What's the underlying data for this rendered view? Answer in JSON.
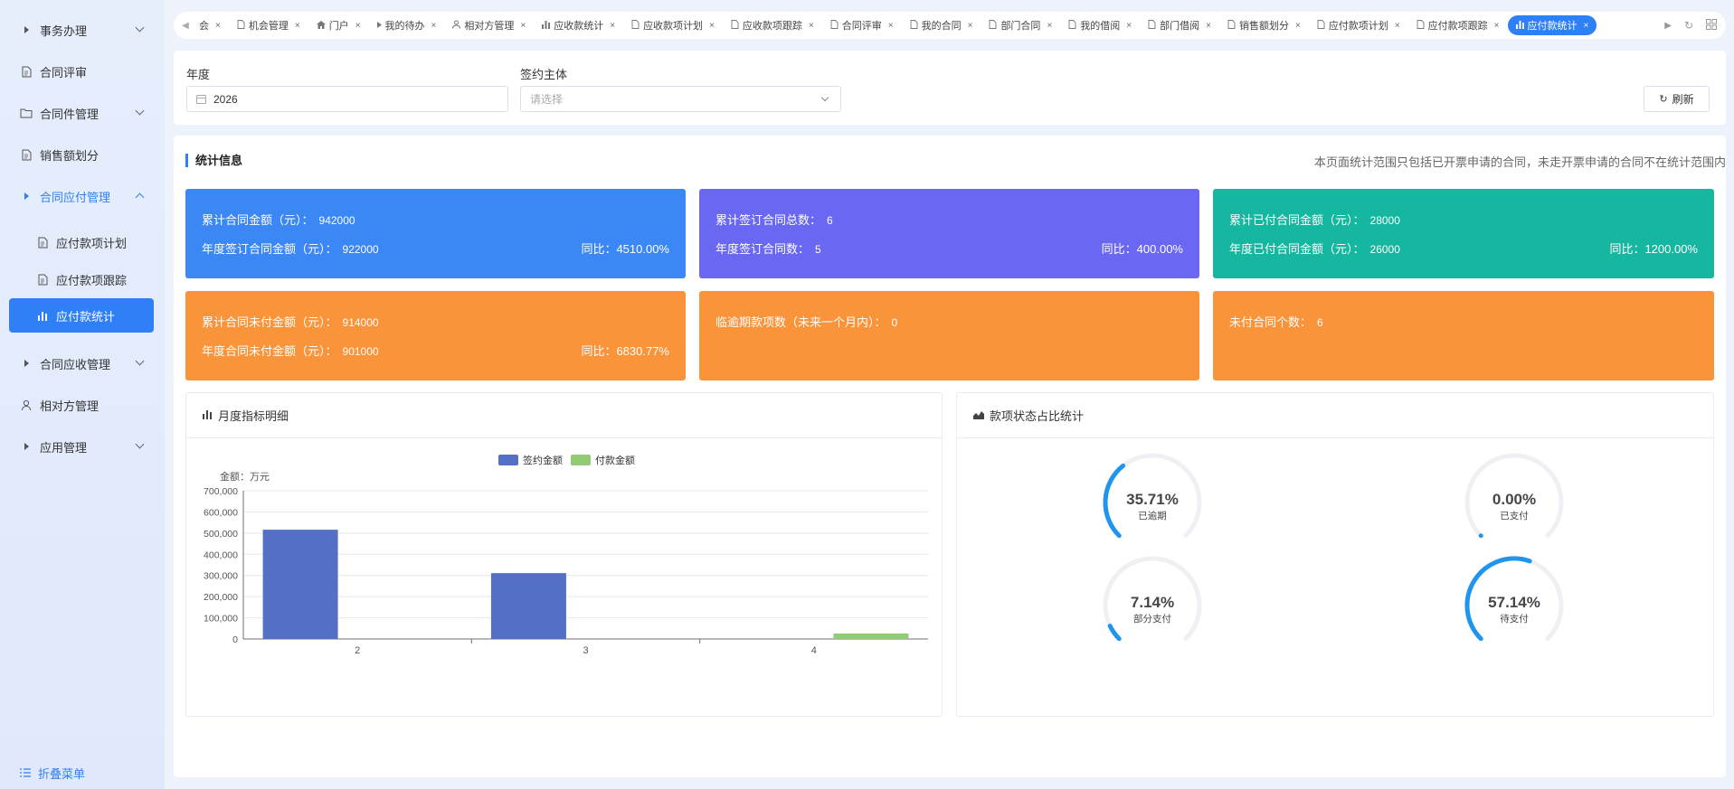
{
  "sidebar": {
    "items": [
      {
        "label": "事务办理",
        "icon": "triangle-right-icon",
        "chevron": "down"
      },
      {
        "label": "合同评审",
        "icon": "document-icon"
      },
      {
        "label": "合同件管理",
        "icon": "folder-icon",
        "chevron": "down"
      },
      {
        "label": "销售额划分",
        "icon": "document-icon"
      },
      {
        "label": "合同应付管理",
        "icon": "triangle-right-icon",
        "chevron": "up",
        "open": true
      }
    ],
    "sub_items": [
      {
        "label": "应付款项计划",
        "icon": "document-icon"
      },
      {
        "label": "应付款项跟踪",
        "icon": "document-icon"
      },
      {
        "label": "应付款统计",
        "icon": "bar-chart-icon",
        "active": true
      }
    ],
    "items_after": [
      {
        "label": "合同应收管理",
        "icon": "triangle-right-icon",
        "chevron": "down"
      },
      {
        "label": "相对方管理",
        "icon": "user-icon"
      },
      {
        "label": "应用管理",
        "icon": "triangle-right-icon",
        "chevron": "down"
      }
    ],
    "fold_label": "折叠菜单"
  },
  "tabs": [
    {
      "label": "会",
      "icon": ""
    },
    {
      "label": "机会管理",
      "icon": "document-icon"
    },
    {
      "label": "门户",
      "icon": "home-icon"
    },
    {
      "label": "我的待办",
      "icon": "triangle-right-icon"
    },
    {
      "label": "相对方管理",
      "icon": "user-icon"
    },
    {
      "label": "应收款统计",
      "icon": "bar-chart-icon"
    },
    {
      "label": "应收款项计划",
      "icon": "document-icon"
    },
    {
      "label": "应收款项跟踪",
      "icon": "document-icon"
    },
    {
      "label": "合同评审",
      "icon": "document-icon"
    },
    {
      "label": "我的合同",
      "icon": "document-icon"
    },
    {
      "label": "部门合同",
      "icon": "document-icon"
    },
    {
      "label": "我的借阅",
      "icon": "document-icon"
    },
    {
      "label": "部门借阅",
      "icon": "document-icon"
    },
    {
      "label": "销售额划分",
      "icon": "document-icon"
    },
    {
      "label": "应付款项计划",
      "icon": "document-icon"
    },
    {
      "label": "应付款项跟踪",
      "icon": "document-icon"
    },
    {
      "label": "应付款统计",
      "icon": "bar-chart-icon",
      "active": true
    }
  ],
  "filter": {
    "year_label": "年度",
    "year_value": "2026",
    "entity_label": "签约主体",
    "entity_placeholder": "请选择",
    "refresh_label": "刷新"
  },
  "stats": {
    "title": "统计信息",
    "note": "本页面统计范围只包括已开票申请的合同，未走开票申请的合同不在统计范围内",
    "cards": [
      {
        "color": "blue",
        "l1_label": "累计合同金额（元）：",
        "l1_value": "942000",
        "l2_label": "年度签订合同金额（元）：",
        "l2_value": "922000",
        "r2": "同比：4510.00%"
      },
      {
        "color": "purple",
        "l1_label": "累计签订合同总数：",
        "l1_value": "6",
        "l2_label": "年度签订合同数：",
        "l2_value": "5",
        "r2": "同比：400.00%"
      },
      {
        "color": "teal",
        "l1_label": "累计已付合同金额（元）：",
        "l1_value": "28000",
        "l2_label": "年度已付合同金额（元）：",
        "l2_value": "26000",
        "r2": "同比：1200.00%"
      },
      {
        "color": "orange",
        "l1_label": "累计合同未付金额（元）：",
        "l1_value": "914000",
        "l2_label": "年度合同未付金额（元）：",
        "l2_value": "901000",
        "r2": "同比：6830.77%"
      },
      {
        "color": "orange",
        "l1_label": "临逾期款项数（未来一个月内）：",
        "l1_value": "0",
        "l2_label": "",
        "l2_value": "",
        "r2": ""
      },
      {
        "color": "orange",
        "l1_label": "未付合同个数：",
        "l1_value": "6",
        "l2_label": "",
        "l2_value": "",
        "r2": ""
      }
    ]
  },
  "bar_panel": {
    "title": "月度指标明细",
    "icon": "bar-chart-icon"
  },
  "gauge_panel": {
    "title": "款项状态占比统计",
    "icon": "area-chart-icon"
  },
  "chart_data": [
    {
      "type": "bar",
      "ylabel": "金额：万元",
      "categories": [
        "2",
        "3",
        "4"
      ],
      "series": [
        {
          "name": "签约金额",
          "color": "#5470c6",
          "values": [
            516000,
            311000,
            0
          ]
        },
        {
          "name": "付款金额",
          "color": "#91cc75",
          "values": [
            0,
            0,
            26000
          ]
        }
      ],
      "ylim": [
        0,
        700000
      ],
      "yticks": [
        "0",
        "100,000",
        "200,000",
        "300,000",
        "400,000",
        "500,000",
        "600,000",
        "700,000"
      ],
      "legend": "top-center",
      "grid": true
    },
    {
      "type": "gauge",
      "items": [
        {
          "label": "已逾期",
          "value": 35.71,
          "display": "35.71%"
        },
        {
          "label": "已支付",
          "value": 0.0,
          "display": "0.00%"
        },
        {
          "label": "部分支付",
          "value": 7.14,
          "display": "7.14%"
        },
        {
          "label": "待支付",
          "value": 57.14,
          "display": "57.14%"
        }
      ],
      "color": "#1f95f0"
    }
  ]
}
